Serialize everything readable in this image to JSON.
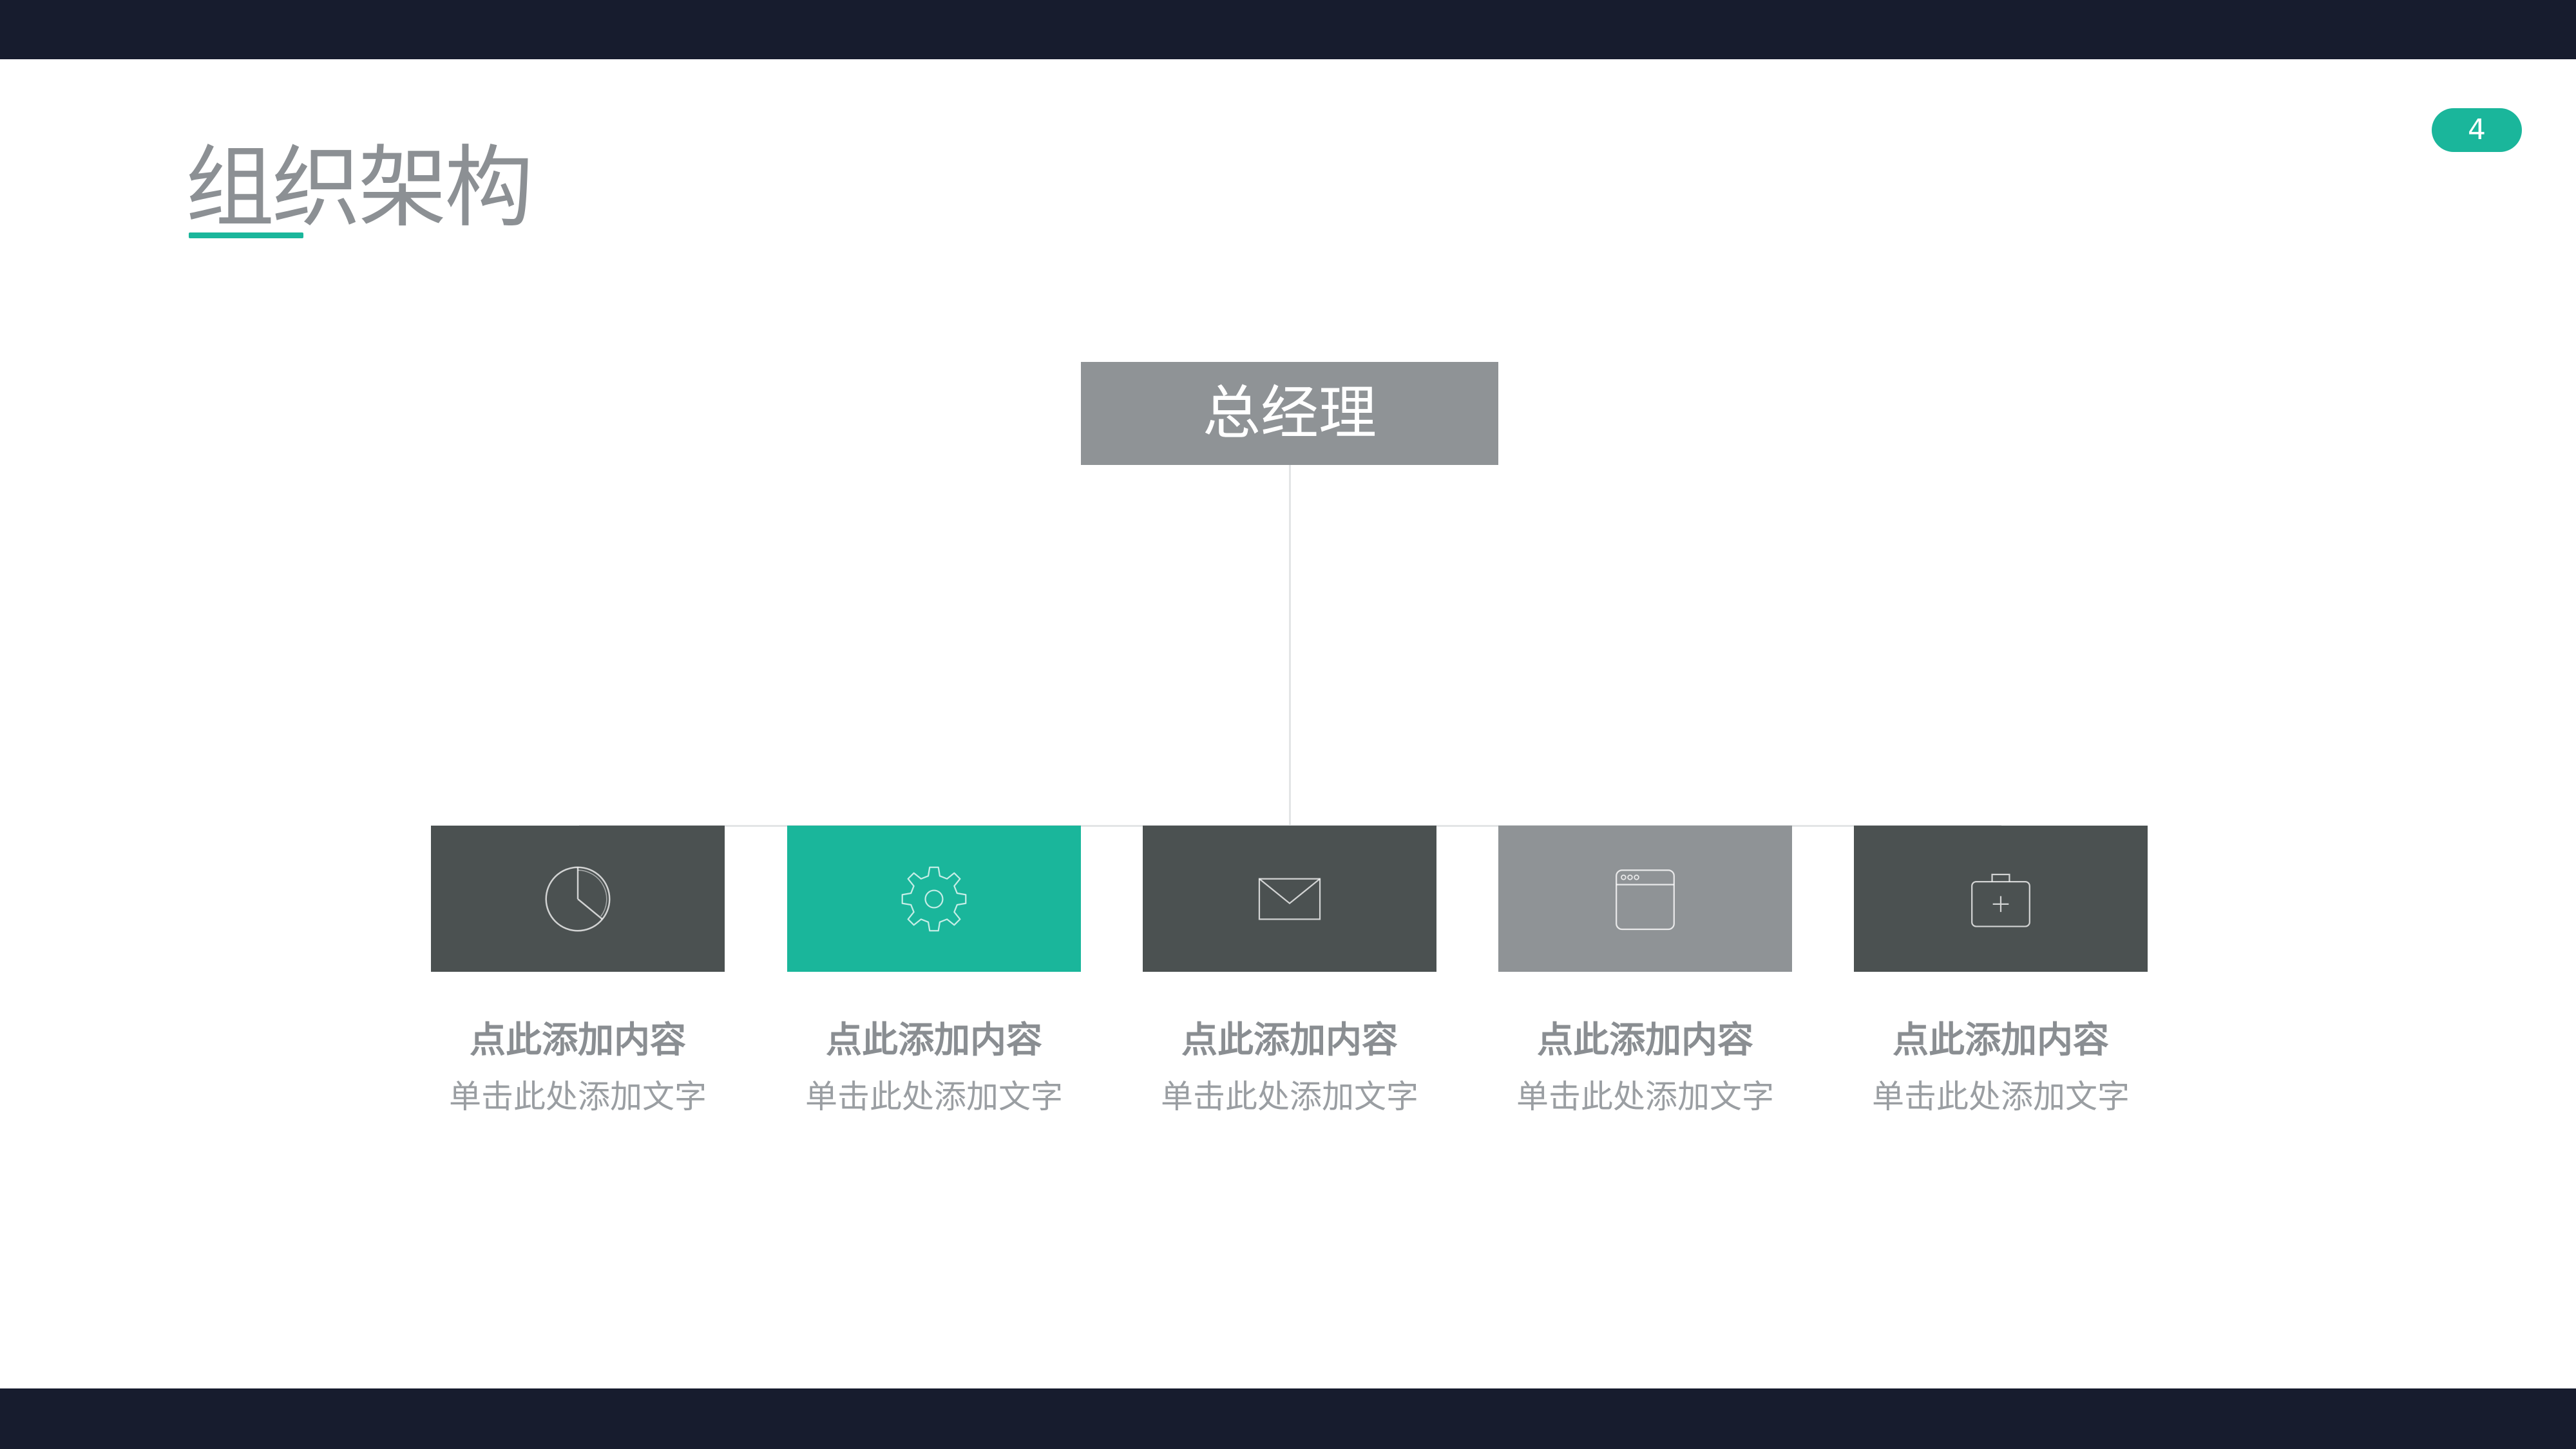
{
  "header": {
    "title": "组织架构",
    "page_number": "4"
  },
  "colors": {
    "dark_bar": "#171c2e",
    "accent": "#1ab69b",
    "dark_box": "#4b5151",
    "gray_box": "#8f9396"
  },
  "root": {
    "label": "总经理"
  },
  "nodes": [
    {
      "title": "点此添加内容",
      "subtitle": "单击此处添加文字",
      "icon": "pie-chart-icon",
      "color": "#4b5151"
    },
    {
      "title": "点此添加内容",
      "subtitle": "单击此处添加文字",
      "icon": "gear-icon",
      "color": "#1ab69b"
    },
    {
      "title": "点此添加内容",
      "subtitle": "单击此处添加文字",
      "icon": "envelope-icon",
      "color": "#4b5151"
    },
    {
      "title": "点此添加内容",
      "subtitle": "单击此处添加文字",
      "icon": "browser-window-icon",
      "color": "#8f9396"
    },
    {
      "title": "点此添加内容",
      "subtitle": "单击此处添加文字",
      "icon": "briefcase-icon",
      "color": "#4b5151"
    }
  ]
}
